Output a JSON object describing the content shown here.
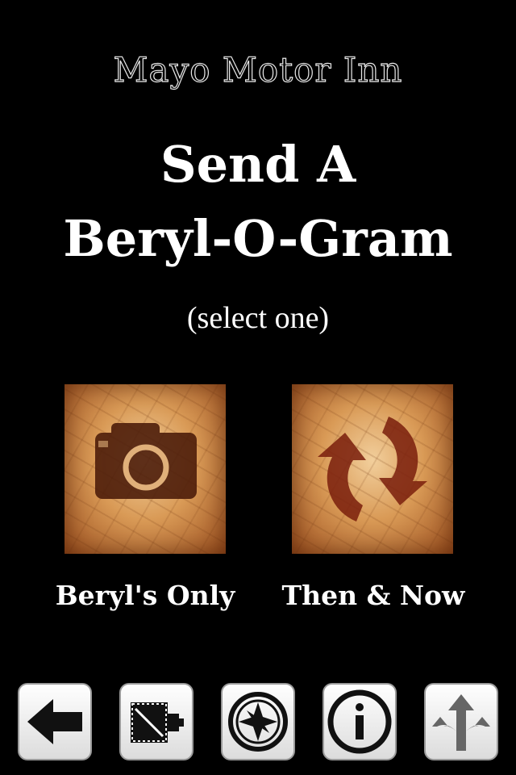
{
  "header": {
    "venue": "Mayo Motor Inn",
    "title_line1": "Send A",
    "title_line2": "Beryl-O-Gram",
    "hint": "(select one)"
  },
  "options": [
    {
      "label": "Beryl's Only",
      "icon": "camera-icon"
    },
    {
      "label": "Then & Now",
      "icon": "refresh-arrows-icon"
    }
  ],
  "toolbar": [
    {
      "icon": "back-arrow-icon"
    },
    {
      "icon": "vintage-camera-icon"
    },
    {
      "icon": "compass-icon"
    },
    {
      "icon": "info-icon"
    },
    {
      "icon": "share-arrows-icon"
    }
  ],
  "colors": {
    "background": "#000000",
    "tile_light": "#f2cf9c",
    "tile_dark": "#9c4f1e",
    "icon_brown": "#4a1a08"
  }
}
